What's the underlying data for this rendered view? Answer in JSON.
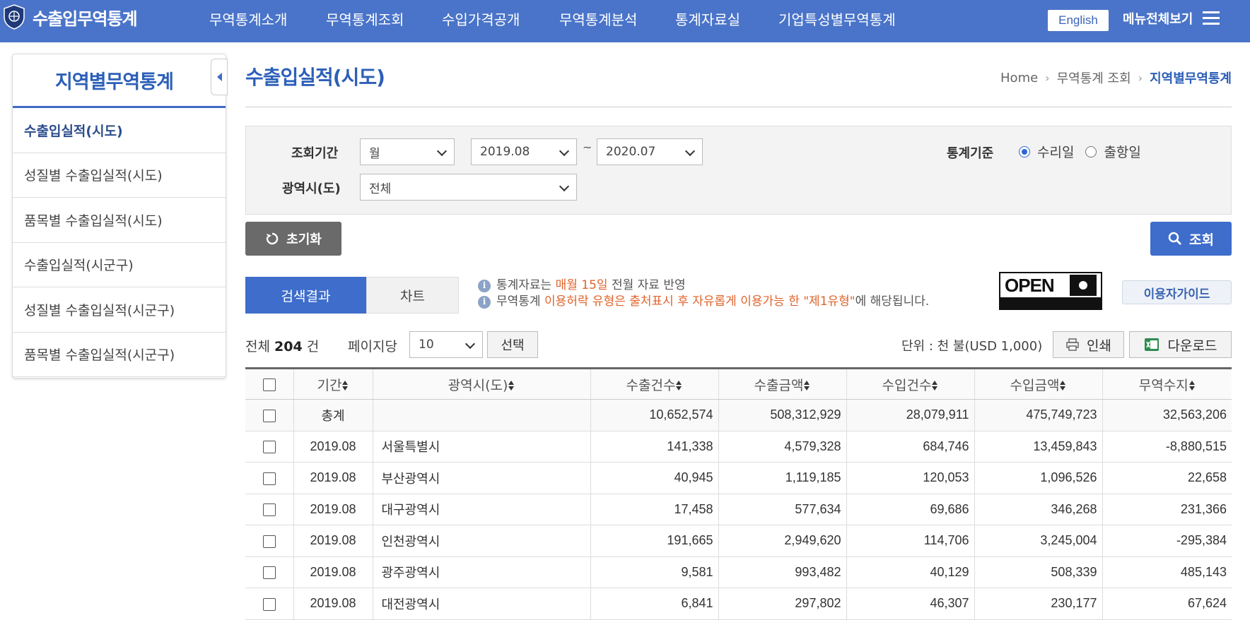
{
  "header": {
    "logo_text": "수출입무역통계",
    "nav": [
      "무역통계소개",
      "무역통계조회",
      "수입가격공개",
      "무역통계분석",
      "통계자료실",
      "기업특성별무역통계"
    ],
    "english_label": "English",
    "all_menu_label": "메뉴전체보기"
  },
  "sidebar": {
    "title": "지역별무역통계",
    "items": [
      {
        "label": "수출입실적(시도)",
        "active": true
      },
      {
        "label": "성질별 수출입실적(시도)",
        "active": false
      },
      {
        "label": "품목별 수출입실적(시도)",
        "active": false
      },
      {
        "label": "수출입실적(시군구)",
        "active": false
      },
      {
        "label": "성질별 수출입실적(시군구)",
        "active": false
      },
      {
        "label": "품목별 수출입실적(시군구)",
        "active": false
      }
    ]
  },
  "page": {
    "title": "수출입실적(시도)",
    "breadcrumb": [
      "Home",
      "무역통계 조회",
      "지역별무역통계"
    ]
  },
  "search": {
    "period_label": "조회기간",
    "period_type": "월",
    "period_from": "2019.08",
    "period_to": "2020.07",
    "tilde": "~",
    "basis_label": "통계기준",
    "basis_options": [
      "수리일",
      "출항일"
    ],
    "basis_selected": "수리일",
    "region_label": "광역시(도)",
    "region_value": "전체",
    "reset_label": "초기화",
    "search_label": "조회"
  },
  "tabs": [
    "검색결과",
    "차트"
  ],
  "notice": {
    "line1_pre": "통계자료는 ",
    "line1_hl": "매월 15일",
    "line1_post": " 전월 자료 반영",
    "line2_pre": "무역통계 ",
    "line2_hl": "이용허락 유형은 출처표시 후 자유롭게 이용가능 한 \"제1유형\"",
    "line2_post": "에 해당됩니다."
  },
  "open_badge": "OPEN",
  "guide_label": "이용자가이드",
  "results": {
    "total_pre": "전체 ",
    "total_count": "204",
    "total_post": " 건",
    "per_page_label": "페이지당",
    "per_page_value": "10",
    "select_label": "선택",
    "unit_label": "단위 : 천 불(USD 1,000)",
    "print_label": "인쇄",
    "download_label": "다운로드"
  },
  "table": {
    "columns": [
      "기간",
      "광역시(도)",
      "수출건수",
      "수출금액",
      "수입건수",
      "수입금액",
      "무역수지"
    ],
    "rows": [
      [
        "총계",
        "",
        "10,652,574",
        "508,312,929",
        "28,079,911",
        "475,749,723",
        "32,563,206"
      ],
      [
        "2019.08",
        "서울특별시",
        "141,338",
        "4,579,328",
        "684,746",
        "13,459,843",
        "-8,880,515"
      ],
      [
        "2019.08",
        "부산광역시",
        "40,945",
        "1,119,185",
        "120,053",
        "1,096,526",
        "22,658"
      ],
      [
        "2019.08",
        "대구광역시",
        "17,458",
        "577,634",
        "69,686",
        "346,268",
        "231,366"
      ],
      [
        "2019.08",
        "인천광역시",
        "191,665",
        "2,949,620",
        "114,706",
        "3,245,004",
        "-295,384"
      ],
      [
        "2019.08",
        "광주광역시",
        "9,581",
        "993,482",
        "40,129",
        "508,339",
        "485,143"
      ],
      [
        "2019.08",
        "대전광역시",
        "6,841",
        "297,802",
        "46,307",
        "230,177",
        "67,624"
      ]
    ]
  },
  "colors": {
    "header_bg": "#4a74c9",
    "accent": "#3e6dcb",
    "highlight": "#e0632b"
  }
}
